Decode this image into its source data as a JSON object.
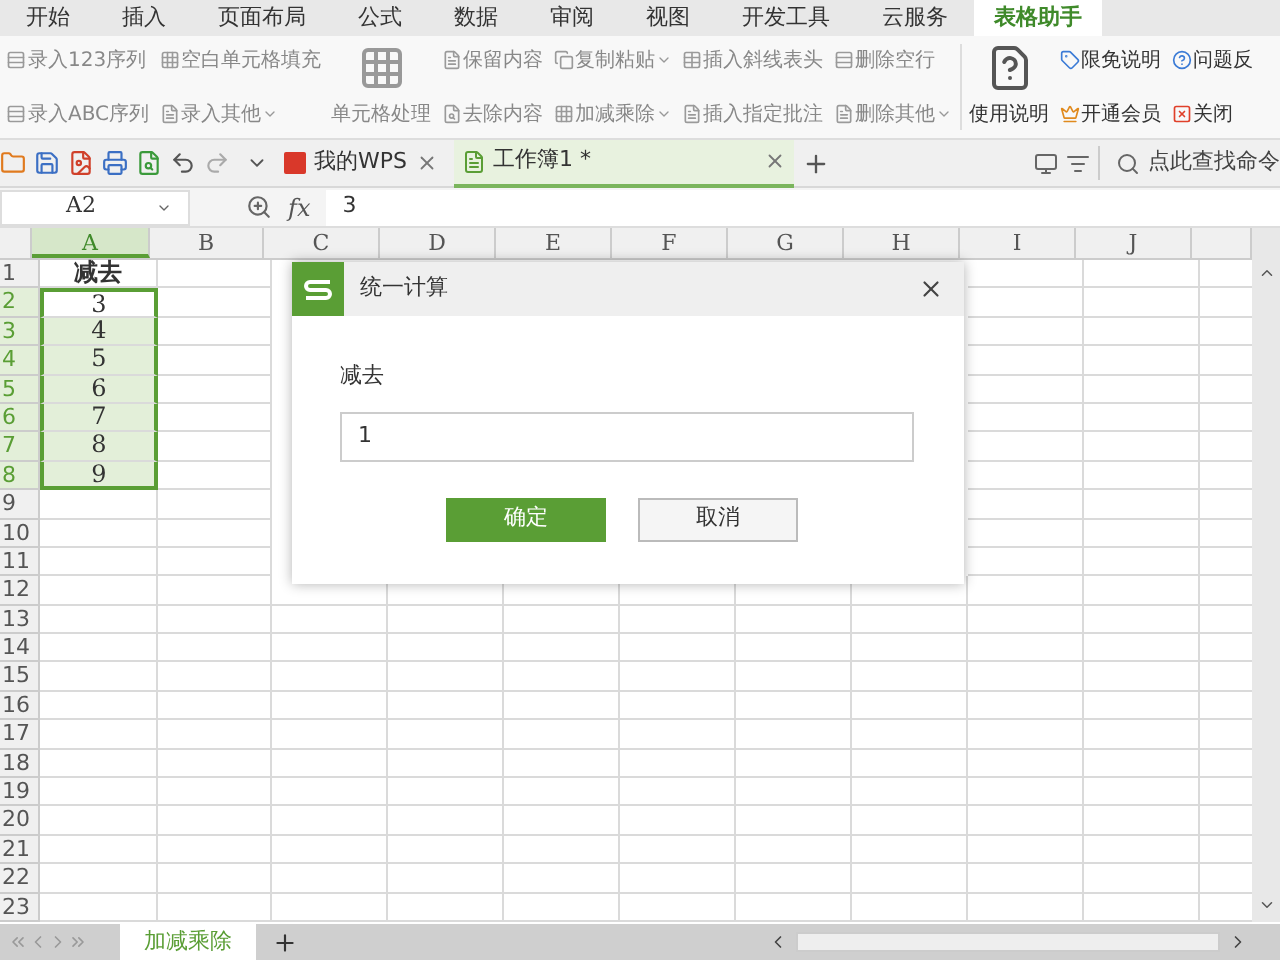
{
  "menu_tabs": [
    {
      "label": "开始",
      "selected": false
    },
    {
      "label": "插入",
      "selected": false
    },
    {
      "label": "页面布局",
      "selected": false
    },
    {
      "label": "公式",
      "selected": false
    },
    {
      "label": "数据",
      "selected": false
    },
    {
      "label": "审阅",
      "selected": false
    },
    {
      "label": "视图",
      "selected": false
    },
    {
      "label": "开发工具",
      "selected": false
    },
    {
      "label": "云服务",
      "selected": false
    },
    {
      "label": "表格助手",
      "selected": true
    }
  ],
  "ribbon": {
    "groups": [
      {
        "kind": "stack",
        "items": [
          {
            "label": "录入123序列",
            "dropdown": false
          },
          {
            "label": "录入ABC序列",
            "dropdown": false
          }
        ]
      },
      {
        "kind": "stack",
        "items": [
          {
            "label": "空白单元格填充",
            "dropdown": false
          },
          {
            "label": "录入其他",
            "dropdown": true
          }
        ]
      },
      {
        "kind": "large",
        "label": "单元格处理"
      },
      {
        "kind": "stack",
        "items": [
          {
            "label": "保留内容",
            "dropdown": false
          },
          {
            "label": "去除内容",
            "dropdown": false
          }
        ]
      },
      {
        "kind": "stack",
        "items": [
          {
            "label": "复制粘贴",
            "dropdown": true
          },
          {
            "label": "加减乘除",
            "dropdown": true
          }
        ]
      },
      {
        "kind": "stack",
        "items": [
          {
            "label": "插入斜线表头",
            "dropdown": false
          },
          {
            "label": "插入指定批注",
            "dropdown": false
          }
        ]
      },
      {
        "kind": "stack",
        "items": [
          {
            "label": "删除空行",
            "dropdown": false
          },
          {
            "label": "删除其他",
            "dropdown": true
          }
        ]
      },
      {
        "kind": "large",
        "label": "使用说明"
      },
      {
        "kind": "stack",
        "items": [
          {
            "label": "限免说明",
            "dropdown": false
          },
          {
            "label": "开通会员",
            "dropdown": false
          }
        ]
      },
      {
        "kind": "stack",
        "items": [
          {
            "label": "问题反",
            "dropdown": false
          },
          {
            "label": "关闭",
            "dropdown": false
          }
        ]
      }
    ]
  },
  "doc_tabs": [
    {
      "label": "我的WPS",
      "selected": false
    },
    {
      "label": "工作簿1 *",
      "selected": true
    }
  ],
  "command_search": {
    "placeholder": "点此查找命令"
  },
  "formula_bar": {
    "name_box": "A2",
    "fx": "fx",
    "value": "3"
  },
  "sheet": {
    "columns": [
      {
        "label": "A",
        "selected": true
      },
      {
        "label": "B",
        "selected": false
      },
      {
        "label": "C",
        "selected": false
      },
      {
        "label": "D",
        "selected": false
      },
      {
        "label": "E",
        "selected": false
      },
      {
        "label": "F",
        "selected": false
      },
      {
        "label": "G",
        "selected": false
      },
      {
        "label": "H",
        "selected": false
      },
      {
        "label": "I",
        "selected": false
      },
      {
        "label": "J",
        "selected": false
      },
      {
        "selected": false
      }
    ],
    "rows": [
      {
        "label": "1",
        "selected": false,
        "cells": [
          {
            "text": "减去",
            "bold": true,
            "selected": false,
            "active": false
          }
        ]
      },
      {
        "label": "2",
        "selected": true,
        "cells": [
          {
            "text": "3",
            "bold": false,
            "selected": true,
            "active": true
          }
        ]
      },
      {
        "label": "3",
        "selected": true,
        "cells": [
          {
            "text": "4",
            "bold": false,
            "selected": true,
            "active": false
          }
        ]
      },
      {
        "label": "4",
        "selected": true,
        "cells": [
          {
            "text": "5",
            "bold": false,
            "selected": true,
            "active": false
          }
        ]
      },
      {
        "label": "5",
        "selected": true,
        "cells": [
          {
            "text": "6",
            "bold": false,
            "selected": true,
            "active": false
          }
        ]
      },
      {
        "label": "6",
        "selected": true,
        "cells": [
          {
            "text": "7",
            "bold": false,
            "selected": true,
            "active": false
          }
        ]
      },
      {
        "label": "7",
        "selected": true,
        "cells": [
          {
            "text": "8",
            "bold": false,
            "selected": true,
            "active": false
          }
        ]
      },
      {
        "label": "8",
        "selected": true,
        "cells": [
          {
            "text": "9",
            "bold": false,
            "selected": true,
            "active": false
          }
        ]
      },
      {
        "label": "9",
        "selected": false
      },
      {
        "label": "10",
        "selected": false
      },
      {
        "label": "11",
        "selected": false
      },
      {
        "label": "12",
        "selected": false
      },
      {
        "label": "13",
        "selected": false
      },
      {
        "label": "14",
        "selected": false
      },
      {
        "label": "15",
        "selected": false
      },
      {
        "label": "16",
        "selected": false
      },
      {
        "label": "17",
        "selected": false
      },
      {
        "label": "18",
        "selected": false
      },
      {
        "label": "19",
        "selected": false
      },
      {
        "label": "20",
        "selected": false
      },
      {
        "label": "21",
        "selected": false
      },
      {
        "label": "22",
        "selected": false
      },
      {
        "label": "23",
        "selected": false
      }
    ]
  },
  "dialog": {
    "title": "统一计算",
    "field_label": "减去",
    "value": "1",
    "buttons": [
      {
        "label": "确定",
        "kind": "primary"
      },
      {
        "label": "取消",
        "kind": "secondary"
      }
    ]
  },
  "sheet_tabs": [
    {
      "label": "加减乘除",
      "selected": true
    }
  ]
}
